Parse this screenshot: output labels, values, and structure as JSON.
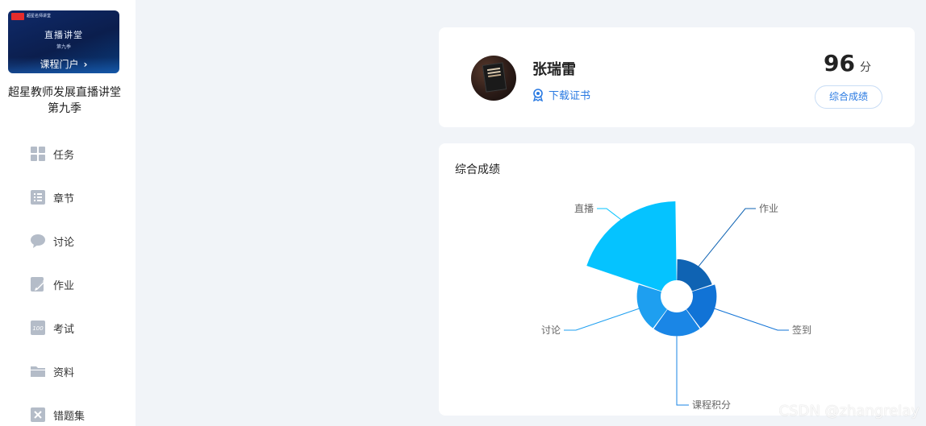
{
  "sidebar": {
    "cover": {
      "logo_text": "超星名师讲堂",
      "title": "直播讲堂",
      "subtitle": "第九季",
      "portal_label": "课程门户",
      "portal_chevron": "›"
    },
    "course_name": "超星教师发展直播讲堂 第九季",
    "nav": [
      {
        "label": "任务",
        "icon": "grid-icon"
      },
      {
        "label": "章节",
        "icon": "list-icon"
      },
      {
        "label": "讨论",
        "icon": "chat-icon"
      },
      {
        "label": "作业",
        "icon": "edit-icon"
      },
      {
        "label": "考试",
        "icon": "exam-icon"
      },
      {
        "label": "资料",
        "icon": "folder-icon"
      },
      {
        "label": "错题集",
        "icon": "close-box-icon"
      }
    ]
  },
  "profile": {
    "name": "张瑞雷",
    "certificate_label": "下载证书",
    "score": "96",
    "score_unit": "分",
    "overall_button": "综合成绩"
  },
  "chart_data": {
    "type": "pie",
    "variant": "rose",
    "title": "综合成绩",
    "categories": [
      "作业",
      "签到",
      "课程积分",
      "讨论",
      "直播"
    ],
    "values": [
      8,
      9,
      9,
      9,
      30
    ],
    "colors": [
      "#0f63b3",
      "#1173d6",
      "#1a86e6",
      "#1e9ff0",
      "#05c3ff"
    ]
  },
  "watermark": "CSDN @zhangrelay"
}
